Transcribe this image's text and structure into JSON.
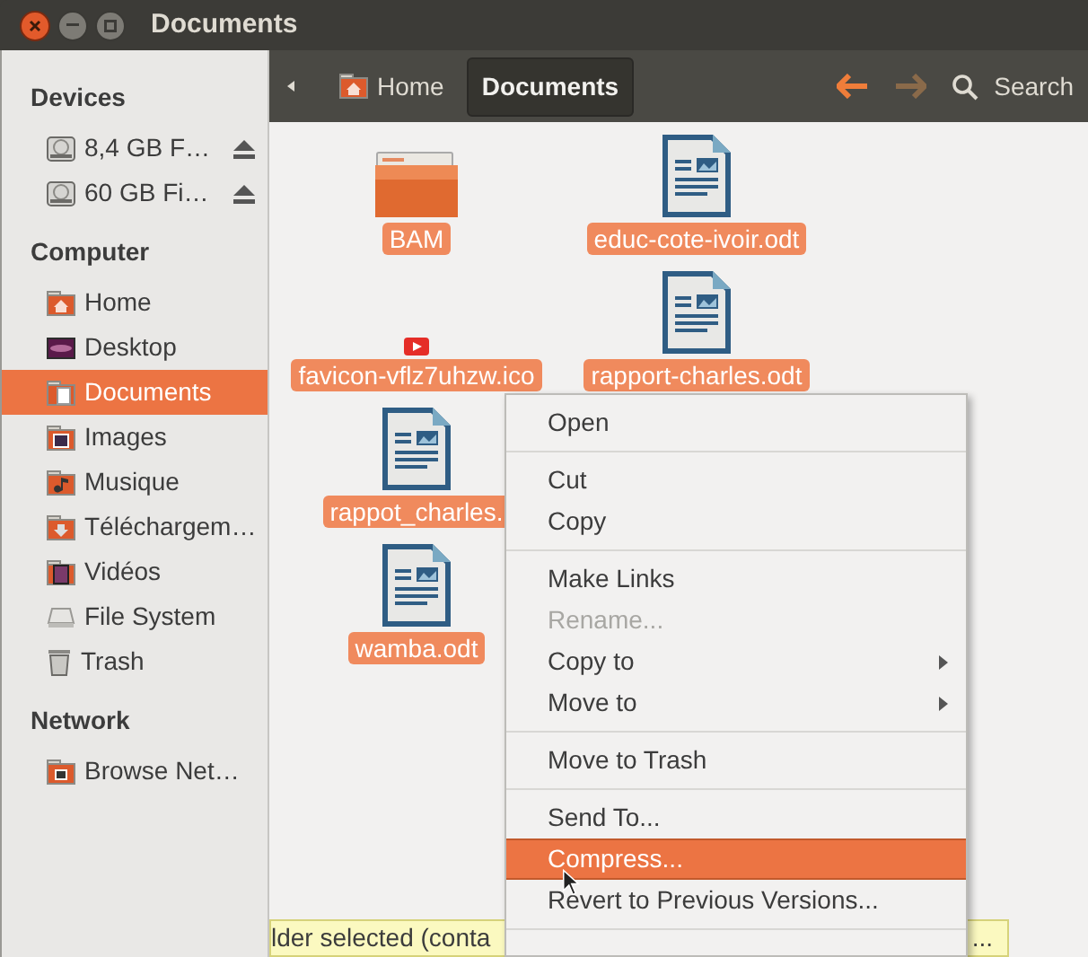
{
  "window": {
    "title": "Documents"
  },
  "sidebar": {
    "sections": [
      {
        "heading": "Devices",
        "items": [
          {
            "label": "8,4 GB F…",
            "kind": "drive",
            "eject": true,
            "selected": false
          },
          {
            "label": "60 GB Fi…",
            "kind": "drive",
            "eject": true,
            "selected": false
          }
        ]
      },
      {
        "heading": "Computer",
        "items": [
          {
            "label": "Home",
            "kind": "home",
            "eject": false,
            "selected": false
          },
          {
            "label": "Desktop",
            "kind": "desktop",
            "eject": false,
            "selected": false
          },
          {
            "label": "Documents",
            "kind": "documents",
            "eject": false,
            "selected": true
          },
          {
            "label": "Images",
            "kind": "images",
            "eject": false,
            "selected": false
          },
          {
            "label": "Musique",
            "kind": "music",
            "eject": false,
            "selected": false
          },
          {
            "label": "Téléchargem…",
            "kind": "downloads",
            "eject": false,
            "selected": false
          },
          {
            "label": "Vidéos",
            "kind": "videos",
            "eject": false,
            "selected": false
          },
          {
            "label": "File System",
            "kind": "filesystem",
            "eject": false,
            "selected": false
          },
          {
            "label": "Trash",
            "kind": "trash",
            "eject": false,
            "selected": false
          }
        ]
      },
      {
        "heading": "Network",
        "items": [
          {
            "label": "Browse Net…",
            "kind": "network",
            "eject": false,
            "selected": false
          }
        ]
      }
    ]
  },
  "toolbar": {
    "breadcrumbs": [
      {
        "label": "Home",
        "selected": false
      },
      {
        "label": "Documents",
        "selected": true
      }
    ],
    "back_disabled": false,
    "forward_disabled": true,
    "search": "Search"
  },
  "files": [
    {
      "name": "BAM",
      "kind": "folder",
      "selected": true
    },
    {
      "name": "favicon-vflz7uhzw.ico",
      "kind": "favicon",
      "selected": true
    },
    {
      "name": "rappot_charles.",
      "kind": "document",
      "selected": true
    },
    {
      "name": "wamba.odt",
      "kind": "document",
      "selected": true
    },
    {
      "name": "educ-cote-ivoir.odt",
      "kind": "document",
      "selected": true
    },
    {
      "name": "rapport-charles.odt",
      "kind": "document",
      "selected": true
    }
  ],
  "context_menu": [
    {
      "kind": "item",
      "label": "Open",
      "disabled": false,
      "selected": false
    },
    {
      "kind": "separator"
    },
    {
      "kind": "item",
      "label": "Cut",
      "disabled": false,
      "selected": false
    },
    {
      "kind": "item",
      "label": "Copy",
      "disabled": false,
      "selected": false
    },
    {
      "kind": "separator"
    },
    {
      "kind": "item",
      "label": "Make Links",
      "disabled": false,
      "selected": false
    },
    {
      "kind": "item",
      "label": "Rename...",
      "disabled": true,
      "selected": false
    },
    {
      "kind": "submenu",
      "label": "Copy to",
      "disabled": false,
      "selected": false
    },
    {
      "kind": "submenu",
      "label": "Move to",
      "disabled": false,
      "selected": false
    },
    {
      "kind": "separator"
    },
    {
      "kind": "item",
      "label": "Move to Trash",
      "disabled": false,
      "selected": false
    },
    {
      "kind": "separator"
    },
    {
      "kind": "item",
      "label": "Send To...",
      "disabled": false,
      "selected": false
    },
    {
      "kind": "item",
      "label": "Compress...",
      "disabled": false,
      "selected": true
    },
    {
      "kind": "item",
      "label": "Revert to Previous Versions...",
      "disabled": false,
      "selected": false
    },
    {
      "kind": "separator"
    }
  ],
  "status_bar": {
    "texts": [
      "lder selected (conta",
      "..."
    ]
  }
}
